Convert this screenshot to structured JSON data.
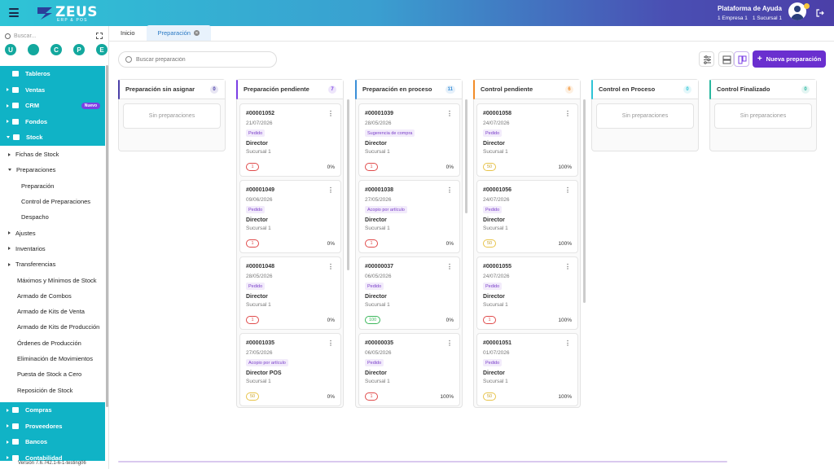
{
  "header": {
    "logo_text": "ZEUS",
    "logo_sub": "ERP & POS",
    "help_title": "Plataforma de Ayuda",
    "empresa": "1 Empresa 1",
    "sucursal": "1 Sucursal 1"
  },
  "sidebar": {
    "search_placeholder": "Buscar...",
    "quick": [
      "U",
      "",
      "C",
      "P",
      "E"
    ],
    "main_items": [
      {
        "label": "Tableros",
        "icon": "dashboard-icon"
      },
      {
        "label": "Ventas",
        "icon": "cart-icon"
      },
      {
        "label": "CRM",
        "icon": "users-icon",
        "badge": "Nuevo"
      },
      {
        "label": "Fondos",
        "icon": "dollar-icon"
      },
      {
        "label": "Stock",
        "icon": "box-icon"
      }
    ],
    "stock_items": [
      {
        "label": "Fichas de Stock",
        "level": 1,
        "arrow": "right"
      },
      {
        "label": "Preparaciones",
        "level": 1,
        "arrow": "down"
      },
      {
        "label": "Preparación",
        "level": 2
      },
      {
        "label": "Control de Preparaciones",
        "level": 2
      },
      {
        "label": "Despacho",
        "level": 2
      },
      {
        "label": "Ajustes",
        "level": 1,
        "arrow": "right"
      },
      {
        "label": "Inventarios",
        "level": 1,
        "arrow": "right"
      },
      {
        "label": "Transferencias",
        "level": 1,
        "arrow": "right"
      },
      {
        "label": "Máximos y Mínimos de Stock",
        "level": 0
      },
      {
        "label": "Armado de Combos",
        "level": 0
      },
      {
        "label": "Armado de Kits de Venta",
        "level": 0
      },
      {
        "label": "Armado de Kits de Producción",
        "level": 0
      },
      {
        "label": "Órdenes de Producción",
        "level": 0
      },
      {
        "label": "Eliminación de Movimientos",
        "level": 0
      },
      {
        "label": "Puesta de Stock a Cero",
        "level": 0
      },
      {
        "label": "Reposición de Stock",
        "level": 0
      }
    ],
    "bottom_items": [
      {
        "label": "Compras"
      },
      {
        "label": "Proveedores"
      },
      {
        "label": "Bancos"
      },
      {
        "label": "Contabilidad"
      }
    ],
    "version": "Versión 7.6.742.1-6-1-testing06"
  },
  "tabs": [
    {
      "label": "Inicio"
    },
    {
      "label": "Preparación"
    }
  ],
  "toolbar": {
    "search_placeholder": "Buscar preparación",
    "new_button": "Nueva preparación"
  },
  "columns": [
    {
      "title": "Preparación sin asignar",
      "count": "0",
      "color": "#4b3fa8",
      "empty": "Sin preparaciones",
      "cards": []
    },
    {
      "title": "Preparación pendiente",
      "count": "7",
      "color": "#7b3fe4",
      "cards": [
        {
          "num": "#00001052",
          "date": "21/07/2026",
          "tag": "Pedido",
          "role": "Director",
          "suc": "Sucursal 1",
          "pill": "1",
          "pill_color": "red",
          "pct": "0%"
        },
        {
          "num": "#00001049",
          "date": "09/06/2026",
          "tag": "Pedido",
          "role": "Director",
          "suc": "Sucursal 1",
          "pill": "1",
          "pill_color": "red",
          "pct": "0%"
        },
        {
          "num": "#00001048",
          "date": "28/05/2026",
          "tag": "Pedido",
          "role": "Director",
          "suc": "Sucursal 1",
          "pill": "1",
          "pill_color": "red",
          "pct": "0%"
        },
        {
          "num": "#00001035",
          "date": "27/05/2026",
          "tag": "Acopio por artículo",
          "role": "Director POS",
          "suc": "Sucursal 1",
          "pill": "50",
          "pill_color": "yellow",
          "pct": "0%"
        }
      ]
    },
    {
      "title": "Preparación en proceso",
      "count": "11",
      "color": "#3a8fd8",
      "cards": [
        {
          "num": "#00001039",
          "date": "28/05/2026",
          "tag": "Sugerencia de compra",
          "role": "Director",
          "suc": "Sucursal 1",
          "pill": "1",
          "pill_color": "red",
          "pct": "0%"
        },
        {
          "num": "#00001038",
          "date": "27/05/2026",
          "tag": "Acopio por artículo",
          "role": "Director",
          "suc": "Sucursal 1",
          "pill": "1",
          "pill_color": "red",
          "pct": "0%"
        },
        {
          "num": "#00000037",
          "date": "06/05/2026",
          "tag": "Pedido",
          "role": "Director",
          "suc": "Sucursal 1",
          "pill": "100",
          "pill_color": "green",
          "pct": "0%"
        },
        {
          "num": "#00000035",
          "date": "06/05/2026",
          "tag": "Pedido",
          "role": "Director",
          "suc": "Sucursal 1",
          "pill": "1",
          "pill_color": "red",
          "pct": "100%"
        }
      ]
    },
    {
      "title": "Control pendiente",
      "count": "6",
      "color": "#f28c28",
      "cards": [
        {
          "num": "#00001058",
          "date": "24/07/2026",
          "tag": "Pedido",
          "role": "Director",
          "suc": "Sucursal 1",
          "pill": "50",
          "pill_color": "yellow",
          "pct": "100%"
        },
        {
          "num": "#00001056",
          "date": "24/07/2026",
          "tag": "Pedido",
          "role": "Director",
          "suc": "Sucursal 1",
          "pill": "50",
          "pill_color": "yellow",
          "pct": "100%"
        },
        {
          "num": "#00001055",
          "date": "24/07/2026",
          "tag": "Pedido",
          "role": "Director",
          "suc": "Sucursal 1",
          "pill": "1",
          "pill_color": "red",
          "pct": "100%"
        },
        {
          "num": "#00001051",
          "date": "01/07/2026",
          "tag": "Pedido",
          "role": "Director",
          "suc": "Sucursal 1",
          "pill": "50",
          "pill_color": "yellow",
          "pct": "100%"
        }
      ]
    },
    {
      "title": "Control en Proceso",
      "count": "0",
      "color": "#2ec4d6",
      "empty": "Sin preparaciones",
      "cards": []
    },
    {
      "title": "Control Finalizado",
      "count": "0",
      "color": "#2ab7a0",
      "empty": "Sin preparaciones",
      "cards": []
    }
  ]
}
